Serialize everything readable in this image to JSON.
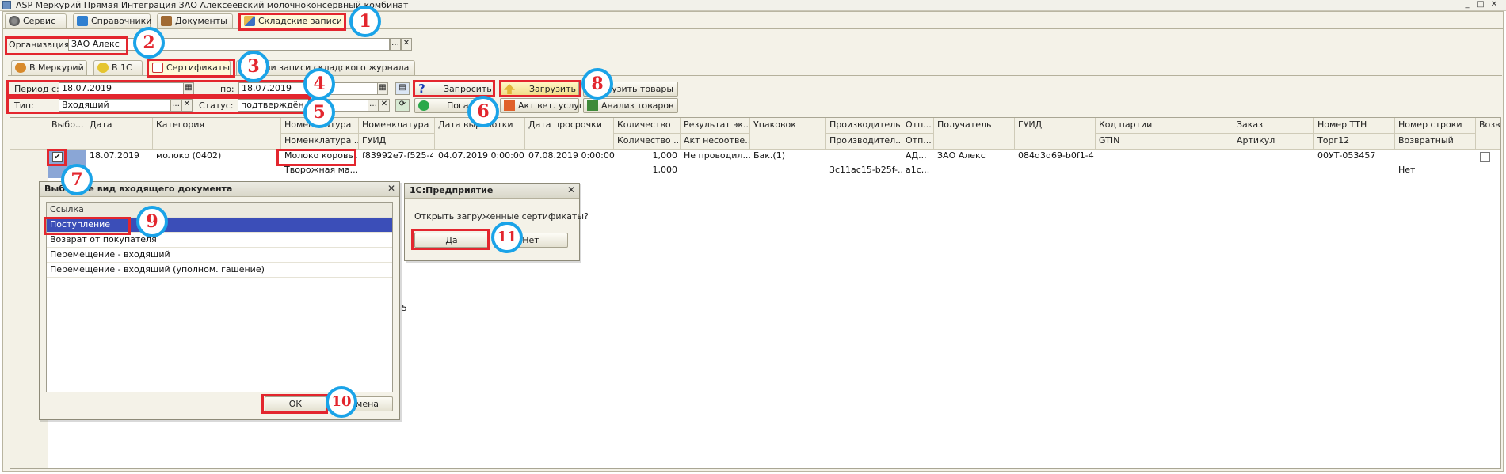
{
  "window": {
    "title": "ASP Меркурий Прямая Интеграция ЗАО Алексеевский молочноконсервный комбинат",
    "controls": [
      "_",
      "□",
      "✕"
    ]
  },
  "main_tabs": [
    {
      "label": "Сервис",
      "icon": "gear-icon"
    },
    {
      "label": "Справочники",
      "icon": "book-icon"
    },
    {
      "label": "Документы",
      "icon": "briefcase-icon"
    },
    {
      "label": "Складские записи",
      "icon": "warehouse-icon",
      "active": true
    }
  ],
  "organization": {
    "label": "Организация:",
    "value": "ЗАО Алекс"
  },
  "sub_tabs": [
    {
      "label": "В Меркурий",
      "icon": "mercury-icon"
    },
    {
      "label": "В 1С",
      "icon": "1c-icon"
    },
    {
      "label": "Сертификаты",
      "icon": "certificate-icon",
      "active": true
    },
    {
      "label": "Версии записи складского журнала"
    }
  ],
  "filters": {
    "period_from_label": "Период с:",
    "period_from_value": "18.07.2019",
    "period_to_label": "по:",
    "period_to_value": "18.07.2019",
    "type_label": "Тип:",
    "type_value": "Входящий",
    "status_label": "Статус:",
    "status_value": "подтверждён"
  },
  "toolbar": {
    "request": "Запросить",
    "settle": "Погас...",
    "load": "Загрузить",
    "vet_act": "Акт вет. услуг",
    "unload_goods": "...згрузить товары",
    "analyze_goods": "Анализ товаров"
  },
  "grid": {
    "headers_top": [
      "Выбр...",
      "Дата",
      "Категория",
      "Номенклатура",
      "Номенклатура",
      "Дата выработки",
      "Дата просрочки",
      "Количество",
      "Результат эк...",
      "Упаковок",
      "Производитель",
      "Отп...",
      "Получатель",
      "ГУИД",
      "Код партии",
      "Заказ",
      "Номер ТТН",
      "Номер строки",
      "Возвр..."
    ],
    "headers_bottom": {
      "nom1": "Номенклатура ...",
      "nom2": "ГУИД",
      "qty": "Количество ...",
      "result": "Акт несоотве...",
      "producer": "Производител...",
      "sender": "Отп...",
      "batch": "GTIN",
      "order": "Артикул",
      "ttn": "Торг12",
      "line": "Возвратный"
    },
    "row1": {
      "date": "18.07.2019",
      "category": "молоко (0402)",
      "nomenclature": "Молоко коровь...",
      "guid1": "f83992e7-f525-4...",
      "prod_date": "04.07.2019 0:00:00",
      "exp_date": "07.08.2019 0:00:00",
      "qty": "1,000",
      "result": "Не проводил...",
      "packs": "Бак.(1)",
      "sender": "АД...",
      "receiver": "ЗАО Алекс",
      "guid": "084d3d69-b0f1-4...",
      "ttn": "00УТ-053457"
    },
    "row2": {
      "nomenclature": "Творожная ма...",
      "qty": "1,000",
      "producer": "3c11ac15-b25f-...",
      "sender": "a1c...",
      "returnable": "Нет"
    },
    "stray_char": "5"
  },
  "choose_dialog": {
    "title": "Выберите вид входящего документа",
    "column": "Ссылка",
    "items": [
      "Поступление",
      "Возврат от покупателя",
      "Перемещение - входящий",
      "Перемещение - входящий (уполном. гашение)"
    ],
    "ok": "ОК",
    "cancel": "Отмена"
  },
  "confirm_dialog": {
    "title": "1С:Предприятие",
    "message": "Открыть загруженные сертификаты?",
    "yes": "Да",
    "no": "Нет"
  },
  "annotations": [
    "1",
    "2",
    "3",
    "4",
    "5",
    "6",
    "7",
    "8",
    "9",
    "10",
    "11"
  ],
  "colors": {
    "highlight": "#e3262e",
    "step_ring": "#1aa3e8",
    "selection": "#3b4eb8"
  }
}
